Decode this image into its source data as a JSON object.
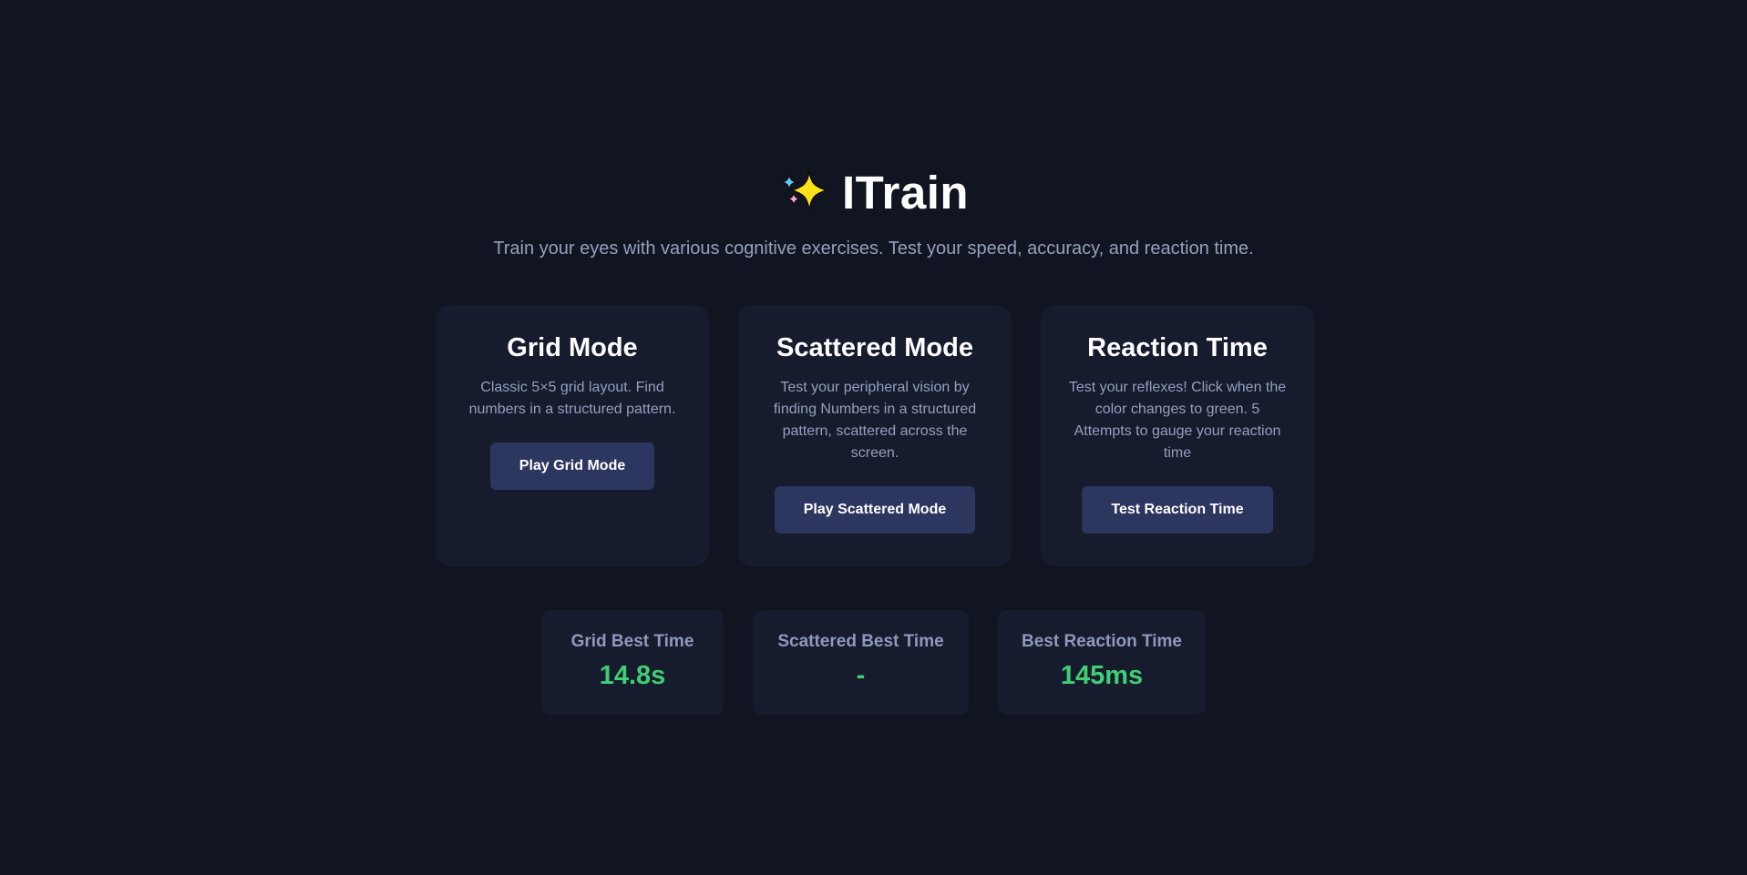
{
  "header": {
    "icon": "sparkles-icon",
    "title": "ITrain",
    "subtitle": "Train your eyes with various cognitive exercises. Test your speed, accuracy, and reaction time."
  },
  "modes": [
    {
      "title": "Grid Mode",
      "description": "Classic 5×5 grid layout. Find numbers in a structured pattern.",
      "button_label": "Play Grid Mode"
    },
    {
      "title": "Scattered Mode",
      "description": "Test your peripheral vision by finding Numbers in a structured pattern, scattered across the screen.",
      "button_label": "Play Scattered Mode"
    },
    {
      "title": "Reaction Time",
      "description": "Test your reflexes! Click when the color changes to green. 5 Attempts to gauge your reaction time",
      "button_label": "Test Reaction Time"
    }
  ],
  "stats": [
    {
      "label": "Grid Best Time",
      "value": "14.8s"
    },
    {
      "label": "Scattered Best Time",
      "value": "-"
    },
    {
      "label": "Best Reaction Time",
      "value": "145ms"
    }
  ],
  "colors": {
    "background": "#111522",
    "card": "#161b2d",
    "button": "#2c365f",
    "muted_text": "#94a0bd",
    "stat_value": "#3fcf72"
  }
}
